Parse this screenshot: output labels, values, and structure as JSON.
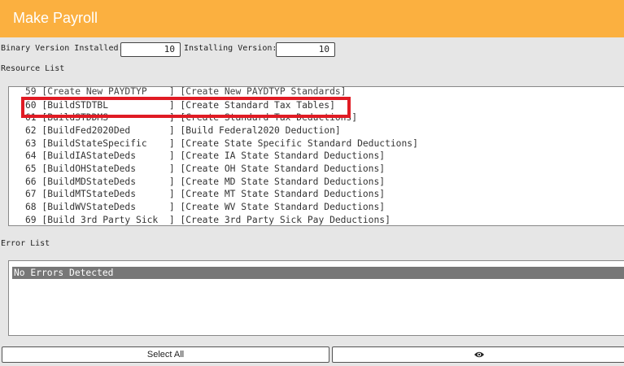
{
  "title": "Make Payroll",
  "binary_version": {
    "label": "Binary Version Installed:",
    "value": "10"
  },
  "installing_version": {
    "label": "Installing Version:",
    "value": "10"
  },
  "resource_list": {
    "label": "Resource List",
    "rows": [
      "59 [Create New PAYDTYP    ] [Create New PAYDTYP Standards]",
      "60 [BuildSTDTBL           ] [Create Standard Tax Tables]",
      "61 [BuildSTDDMS           ] [Create Standard Tax Deductions]",
      "62 [BuildFed2020Ded       ] [Build Federal2020 Deduction]",
      "63 [BuildStateSpecific    ] [Create State Specific Standard Deductions]",
      "64 [BuildIAStateDeds      ] [Create IA State Standard Deductions]",
      "65 [BuildOHStateDeds      ] [Create OH State Standard Deductions]",
      "66 [BuildMDStateDeds      ] [Create MD State Standard Deductions]",
      "67 [BuildMTStateDeds      ] [Create MT State Standard Deductions]",
      "68 [BuildWVStateDeds      ] [Create WV State Standard Deductions]",
      "69 [Build 3rd Party Sick  ] [Create 3rd Party Sick Pay Deductions]"
    ]
  },
  "error_list": {
    "label": "Error List",
    "rows": [
      "No Errors Detected"
    ]
  },
  "buttons": {
    "select_all": "Select All",
    "view_icon": "eye-icon"
  },
  "colors": {
    "header": "#fbb040",
    "highlight": "#e01b24",
    "selected_row": "#777777"
  }
}
